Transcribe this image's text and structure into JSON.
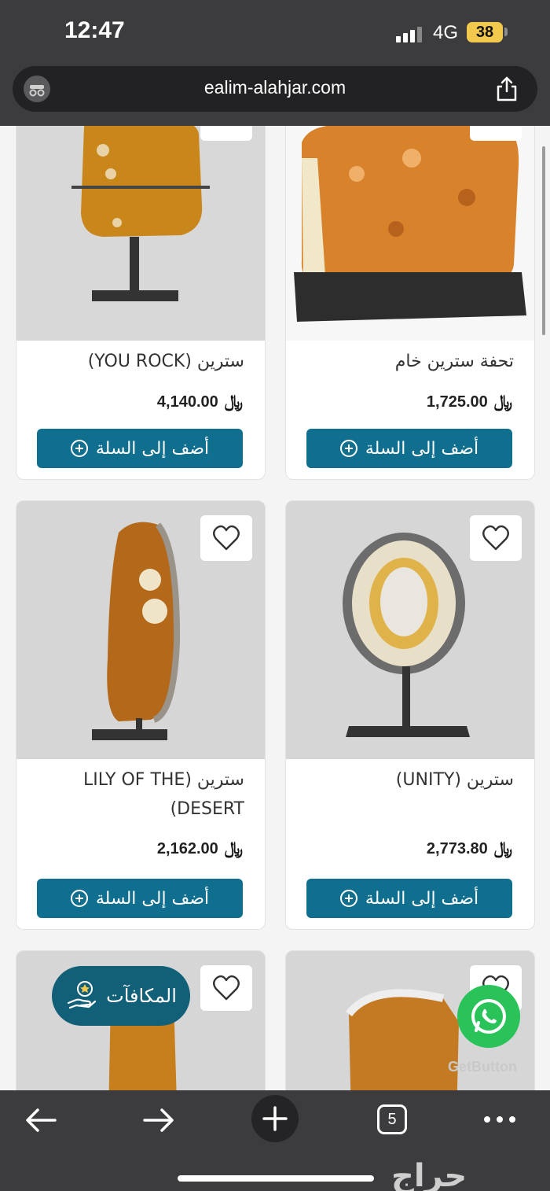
{
  "status_bar": {
    "time": "12:47",
    "network": "4G",
    "battery": "38"
  },
  "browser": {
    "url": "ealim-alahjar.com",
    "tab_count": "5"
  },
  "products": [
    {
      "title": "سترين (YOU ROCK)",
      "price": "4,140.00"
    },
    {
      "title": "تحفة سترين خام",
      "price": "1,725.00"
    },
    {
      "title": "سترين (LILY OF THE DESERT)",
      "price": "2,162.00"
    },
    {
      "title": "سترين (UNITY)",
      "price": "2,773.80"
    }
  ],
  "currency_symbol": "﷼",
  "add_to_cart_label": "أضف إلى السلة",
  "rewards_label": "المكافآت",
  "getbutton_label": "GetButton",
  "watermark": "حراج",
  "colors": {
    "button": "#106f8f",
    "rewards": "#125f78",
    "whatsapp": "#29c35a"
  }
}
